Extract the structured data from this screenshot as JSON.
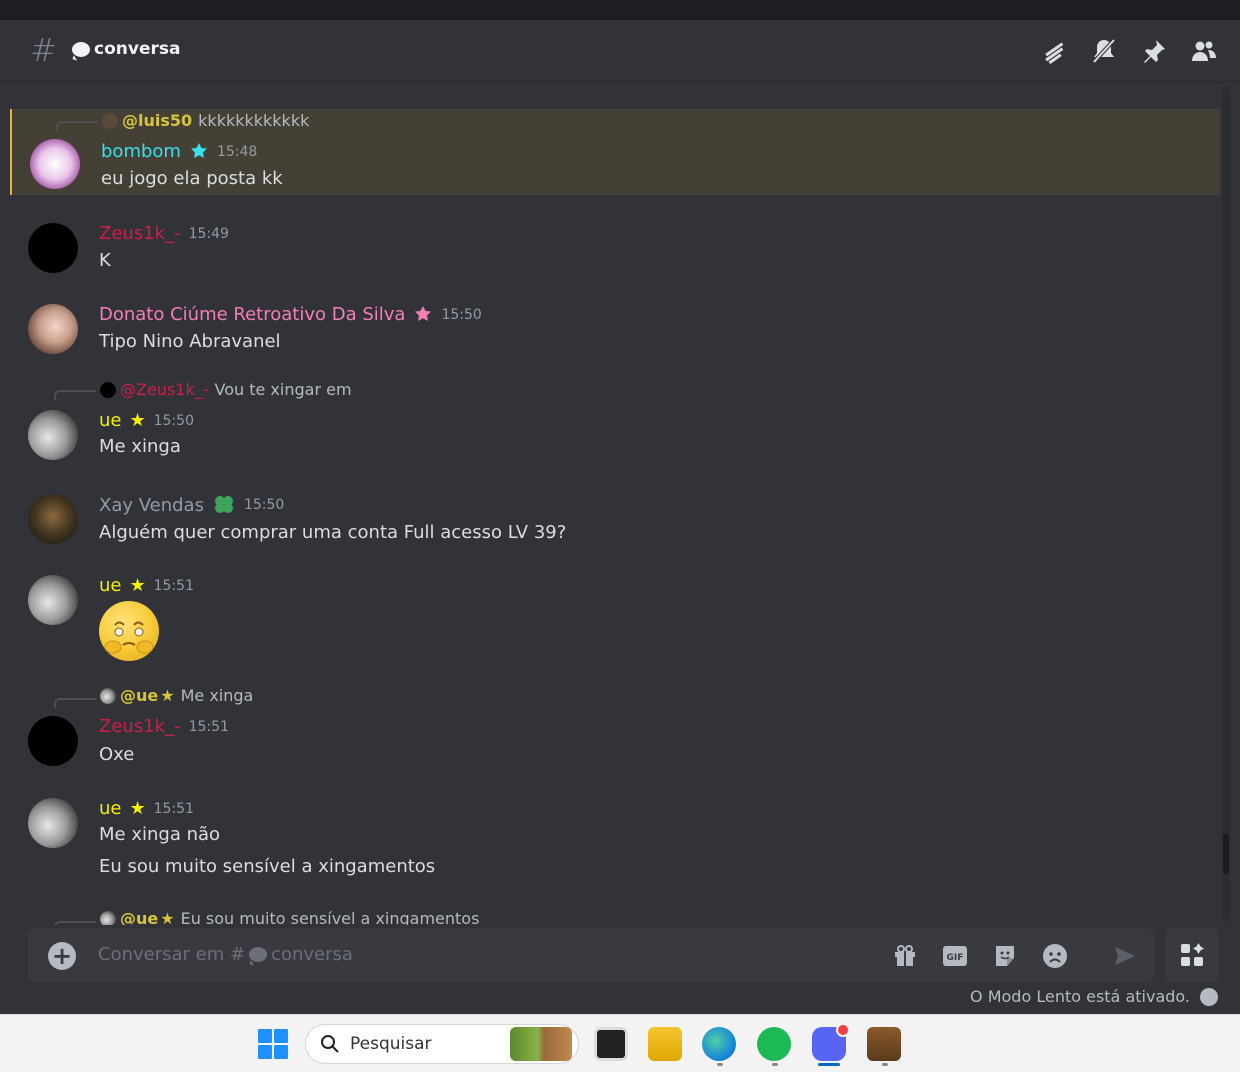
{
  "header": {
    "channel_name": "conversa"
  },
  "messages": [
    {
      "reply": {
        "mention": "@luis50",
        "text": "kkkkkkkkkkkk",
        "color": "#d6c43a"
      },
      "user": "bombom",
      "user_color": "#3be0ec",
      "time": "15:48",
      "lines": [
        "eu jogo ela posta kk"
      ],
      "highlight": true
    },
    {
      "user": "Zeus1k_-",
      "user_color": "#d01d4a",
      "time": "15:49",
      "lines": [
        "K"
      ]
    },
    {
      "user": "Donato Ciúme Retroativo Da Silva",
      "user_color": "#f47fb4",
      "time": "15:50",
      "lines": [
        "Tipo Nino Abravanel"
      ]
    },
    {
      "reply": {
        "mention": "@Zeus1k_-",
        "text": "Vou te xingar em",
        "color": "#d01d4a"
      },
      "user": "ue",
      "user_color": "#f4f000",
      "time": "15:50",
      "lines": [
        "Me xinga"
      ]
    },
    {
      "user": "Xay Vendas",
      "user_color": "#949ba4",
      "time": "15:50",
      "lines": [
        "Alguém quer comprar uma conta Full acesso LV 39?"
      ]
    },
    {
      "user": "ue",
      "user_color": "#f4f000",
      "time": "15:51",
      "lines": []
    },
    {
      "reply": {
        "mention": "@ue",
        "text": "Me xinga",
        "color": "#d6c43a"
      },
      "user": "Zeus1k_-",
      "user_color": "#d01d4a",
      "time": "15:51",
      "lines": [
        "Oxe"
      ]
    },
    {
      "user": "ue",
      "user_color": "#f4f000",
      "time": "15:51",
      "lines": [
        "Me xinga não",
        "Eu sou muito sensível a xingamentos"
      ]
    },
    {
      "reply": {
        "mention": "@ue",
        "text": "Eu sou muito sensível a xingamentos",
        "color": "#d6c43a"
      }
    }
  ],
  "composer": {
    "placeholder_prefix": "Conversar em #",
    "placeholder_channel": "conversa"
  },
  "slowmode_text": "O Modo Lento está ativado.",
  "taskbar": {
    "search_placeholder": "Pesquisar"
  },
  "icons": {
    "header": [
      "threads-icon",
      "mute-icon",
      "pin-icon",
      "members-icon"
    ],
    "composer": [
      "gift-icon",
      "gif-icon",
      "sticker-icon",
      "emoji-icon",
      "send-icon"
    ]
  }
}
